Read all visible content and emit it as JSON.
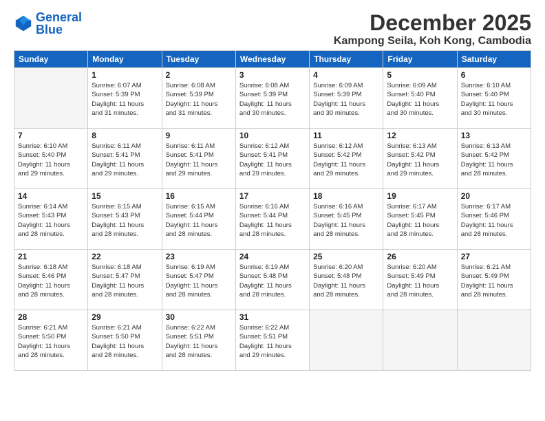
{
  "logo": {
    "text_general": "General",
    "text_blue": "Blue"
  },
  "title": "December 2025",
  "location": "Kampong Seila, Koh Kong, Cambodia",
  "header_days": [
    "Sunday",
    "Monday",
    "Tuesday",
    "Wednesday",
    "Thursday",
    "Friday",
    "Saturday"
  ],
  "weeks": [
    [
      {
        "day": "",
        "sunrise": "",
        "sunset": "",
        "daylight": ""
      },
      {
        "day": "1",
        "sunrise": "6:07 AM",
        "sunset": "5:39 PM",
        "daylight": "11 hours and 31 minutes."
      },
      {
        "day": "2",
        "sunrise": "6:08 AM",
        "sunset": "5:39 PM",
        "daylight": "11 hours and 31 minutes."
      },
      {
        "day": "3",
        "sunrise": "6:08 AM",
        "sunset": "5:39 PM",
        "daylight": "11 hours and 30 minutes."
      },
      {
        "day": "4",
        "sunrise": "6:09 AM",
        "sunset": "5:39 PM",
        "daylight": "11 hours and 30 minutes."
      },
      {
        "day": "5",
        "sunrise": "6:09 AM",
        "sunset": "5:40 PM",
        "daylight": "11 hours and 30 minutes."
      },
      {
        "day": "6",
        "sunrise": "6:10 AM",
        "sunset": "5:40 PM",
        "daylight": "11 hours and 30 minutes."
      }
    ],
    [
      {
        "day": "7",
        "sunrise": "6:10 AM",
        "sunset": "5:40 PM",
        "daylight": "11 hours and 29 minutes."
      },
      {
        "day": "8",
        "sunrise": "6:11 AM",
        "sunset": "5:41 PM",
        "daylight": "11 hours and 29 minutes."
      },
      {
        "day": "9",
        "sunrise": "6:11 AM",
        "sunset": "5:41 PM",
        "daylight": "11 hours and 29 minutes."
      },
      {
        "day": "10",
        "sunrise": "6:12 AM",
        "sunset": "5:41 PM",
        "daylight": "11 hours and 29 minutes."
      },
      {
        "day": "11",
        "sunrise": "6:12 AM",
        "sunset": "5:42 PM",
        "daylight": "11 hours and 29 minutes."
      },
      {
        "day": "12",
        "sunrise": "6:13 AM",
        "sunset": "5:42 PM",
        "daylight": "11 hours and 29 minutes."
      },
      {
        "day": "13",
        "sunrise": "6:13 AM",
        "sunset": "5:42 PM",
        "daylight": "11 hours and 28 minutes."
      }
    ],
    [
      {
        "day": "14",
        "sunrise": "6:14 AM",
        "sunset": "5:43 PM",
        "daylight": "11 hours and 28 minutes."
      },
      {
        "day": "15",
        "sunrise": "6:15 AM",
        "sunset": "5:43 PM",
        "daylight": "11 hours and 28 minutes."
      },
      {
        "day": "16",
        "sunrise": "6:15 AM",
        "sunset": "5:44 PM",
        "daylight": "11 hours and 28 minutes."
      },
      {
        "day": "17",
        "sunrise": "6:16 AM",
        "sunset": "5:44 PM",
        "daylight": "11 hours and 28 minutes."
      },
      {
        "day": "18",
        "sunrise": "6:16 AM",
        "sunset": "5:45 PM",
        "daylight": "11 hours and 28 minutes."
      },
      {
        "day": "19",
        "sunrise": "6:17 AM",
        "sunset": "5:45 PM",
        "daylight": "11 hours and 28 minutes."
      },
      {
        "day": "20",
        "sunrise": "6:17 AM",
        "sunset": "5:46 PM",
        "daylight": "11 hours and 28 minutes."
      }
    ],
    [
      {
        "day": "21",
        "sunrise": "6:18 AM",
        "sunset": "5:46 PM",
        "daylight": "11 hours and 28 minutes."
      },
      {
        "day": "22",
        "sunrise": "6:18 AM",
        "sunset": "5:47 PM",
        "daylight": "11 hours and 28 minutes."
      },
      {
        "day": "23",
        "sunrise": "6:19 AM",
        "sunset": "5:47 PM",
        "daylight": "11 hours and 28 minutes."
      },
      {
        "day": "24",
        "sunrise": "6:19 AM",
        "sunset": "5:48 PM",
        "daylight": "11 hours and 28 minutes."
      },
      {
        "day": "25",
        "sunrise": "6:20 AM",
        "sunset": "5:48 PM",
        "daylight": "11 hours and 28 minutes."
      },
      {
        "day": "26",
        "sunrise": "6:20 AM",
        "sunset": "5:49 PM",
        "daylight": "11 hours and 28 minutes."
      },
      {
        "day": "27",
        "sunrise": "6:21 AM",
        "sunset": "5:49 PM",
        "daylight": "11 hours and 28 minutes."
      }
    ],
    [
      {
        "day": "28",
        "sunrise": "6:21 AM",
        "sunset": "5:50 PM",
        "daylight": "11 hours and 28 minutes."
      },
      {
        "day": "29",
        "sunrise": "6:21 AM",
        "sunset": "5:50 PM",
        "daylight": "11 hours and 28 minutes."
      },
      {
        "day": "30",
        "sunrise": "6:22 AM",
        "sunset": "5:51 PM",
        "daylight": "11 hours and 28 minutes."
      },
      {
        "day": "31",
        "sunrise": "6:22 AM",
        "sunset": "5:51 PM",
        "daylight": "11 hours and 29 minutes."
      },
      {
        "day": "",
        "sunrise": "",
        "sunset": "",
        "daylight": ""
      },
      {
        "day": "",
        "sunrise": "",
        "sunset": "",
        "daylight": ""
      },
      {
        "day": "",
        "sunrise": "",
        "sunset": "",
        "daylight": ""
      }
    ]
  ]
}
